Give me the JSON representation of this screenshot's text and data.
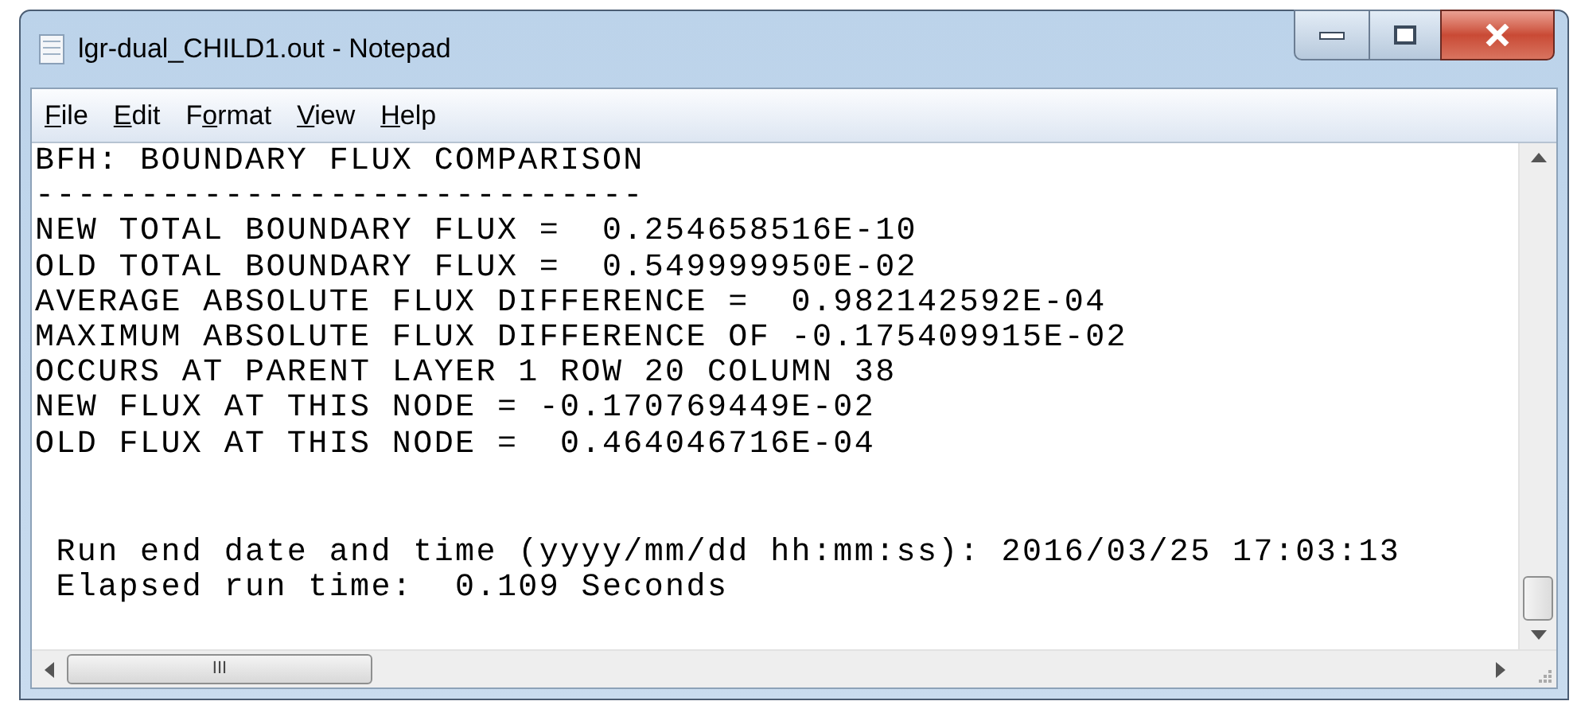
{
  "window": {
    "title": "lgr-dual_CHILD1.out - Notepad"
  },
  "menu": [
    {
      "access_key": "F",
      "rest": "ile"
    },
    {
      "access_key": "E",
      "rest": "dit"
    },
    {
      "before": "F",
      "access_key": "o",
      "rest": "rmat"
    },
    {
      "access_key": "V",
      "rest": "iew"
    },
    {
      "access_key": "H",
      "rest": "elp"
    }
  ],
  "lines": [
    "BFH: BOUNDARY FLUX COMPARISON",
    "-----------------------------",
    "NEW TOTAL BOUNDARY FLUX =  0.254658516E-10",
    "OLD TOTAL BOUNDARY FLUX =  0.549999950E-02",
    "AVERAGE ABSOLUTE FLUX DIFFERENCE =  0.982142592E-04",
    "MAXIMUM ABSOLUTE FLUX DIFFERENCE OF -0.175409915E-02",
    "OCCURS AT PARENT LAYER 1 ROW 20 COLUMN 38",
    "NEW FLUX AT THIS NODE = -0.170769449E-02",
    "OLD FLUX AT THIS NODE =  0.464046716E-04"
  ],
  "footer_lines": [
    " Run end date and time (yyyy/mm/dd hh:mm:ss): 2016/03/25 17:03:13",
    " Elapsed run time:  0.109 Seconds"
  ],
  "scrollbars": {
    "horizontal_grip": "III"
  }
}
